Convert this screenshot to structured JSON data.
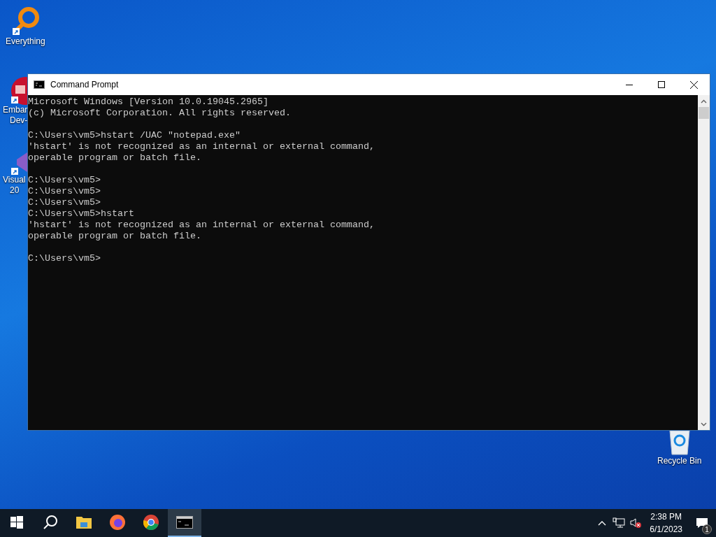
{
  "desktop_icons": [
    {
      "kind": "everything",
      "lines": [
        "Everything"
      ]
    },
    {
      "kind": "embarcadero",
      "lines": [
        "Embar",
        "Dev-"
      ]
    },
    {
      "kind": "visualstudio",
      "lines": [
        "Visual",
        "20"
      ]
    },
    {
      "kind": "recycle",
      "lines": [
        "Recycle Bin"
      ]
    }
  ],
  "window": {
    "title": "Command Prompt",
    "console_blocks": [
      [
        "Microsoft Windows [Version 10.0.19045.2965]",
        "(c) Microsoft Corporation. All rights reserved."
      ],
      [
        "C:\\Users\\vm5>hstart /UAC \"notepad.exe\"",
        "'hstart' is not recognized as an internal or external command,",
        "operable program or batch file."
      ],
      [
        "C:\\Users\\vm5>",
        "C:\\Users\\vm5>",
        "C:\\Users\\vm5>",
        "C:\\Users\\vm5>hstart",
        "'hstart' is not recognized as an internal or external command,",
        "operable program or batch file."
      ],
      [
        "C:\\Users\\vm5>"
      ]
    ]
  },
  "taskbar": {
    "apps": [
      {
        "kind": "start",
        "selected": false
      },
      {
        "kind": "search",
        "selected": false
      },
      {
        "kind": "explorer",
        "selected": false
      },
      {
        "kind": "firefox",
        "selected": false
      },
      {
        "kind": "chrome",
        "selected": false
      },
      {
        "kind": "cmd",
        "selected": true
      }
    ],
    "time": "2:38 PM",
    "date": "6/1/2023",
    "notification_count": "1"
  }
}
